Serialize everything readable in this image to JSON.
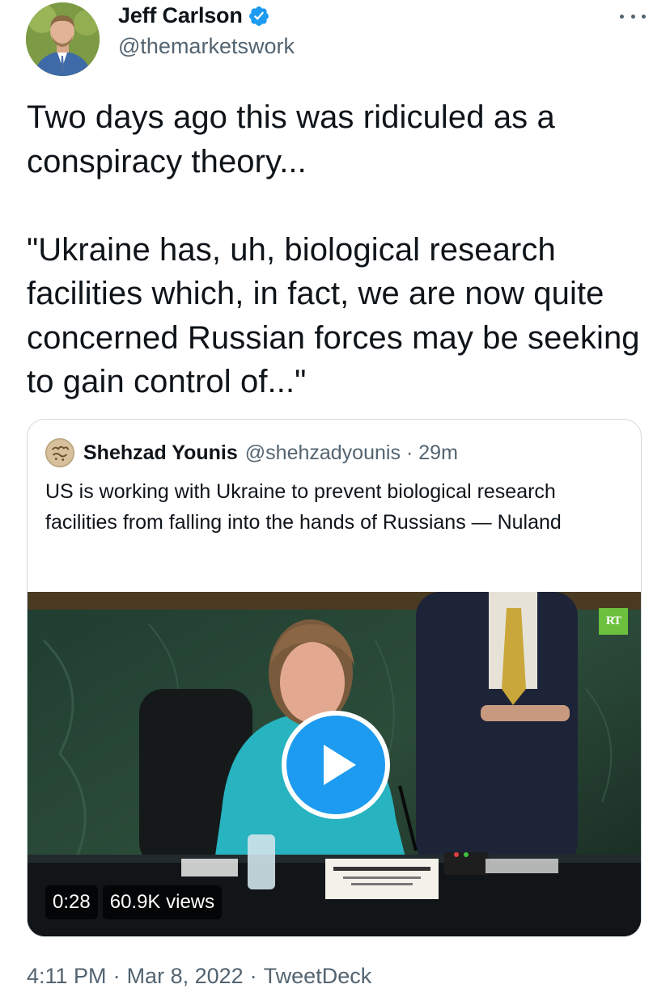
{
  "author": {
    "name": "Jeff Carlson",
    "handle": "@themarketswork",
    "avatar_icon": "profile-photo",
    "verified_color": "#1d9bf0"
  },
  "tweet": {
    "text": "Two days ago this was ridiculed as a conspiracy theory...\n\n\"Ukraine has, uh, biological research facilities which, in fact, we are now quite concerned Russian forces may be seeking to gain control of...\""
  },
  "quote": {
    "name": "Shehzad Younis",
    "handle": "@shehzadyounis",
    "separator": "·",
    "time": "29m",
    "text": "US is working with Ukraine to prevent biological research facilities from falling into the hands of Russians — Nuland",
    "video": {
      "channel_badge": "RT",
      "duration": "0:28",
      "views": "60.9K views",
      "play_icon": "play-icon",
      "accent_color": "#1d9bf0"
    }
  },
  "footer": {
    "time": "4:11 PM",
    "date": "Mar 8, 2022",
    "source": "TweetDeck",
    "separator": "·"
  }
}
